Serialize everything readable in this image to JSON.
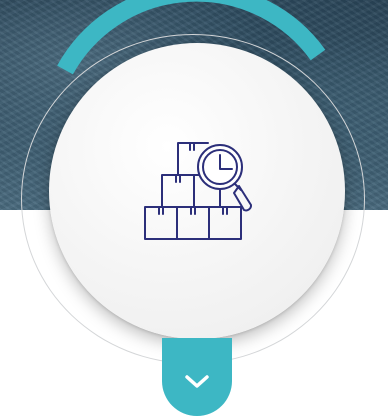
{
  "theme": {
    "accent": "#3db7c4",
    "icon_color": "#2c2f7a",
    "disc_color": "#f2f2f2",
    "ring_color": "#d4d6d8"
  },
  "icons": {
    "main": "boxes-magnifier-icon",
    "expand": "chevron-down-icon"
  }
}
